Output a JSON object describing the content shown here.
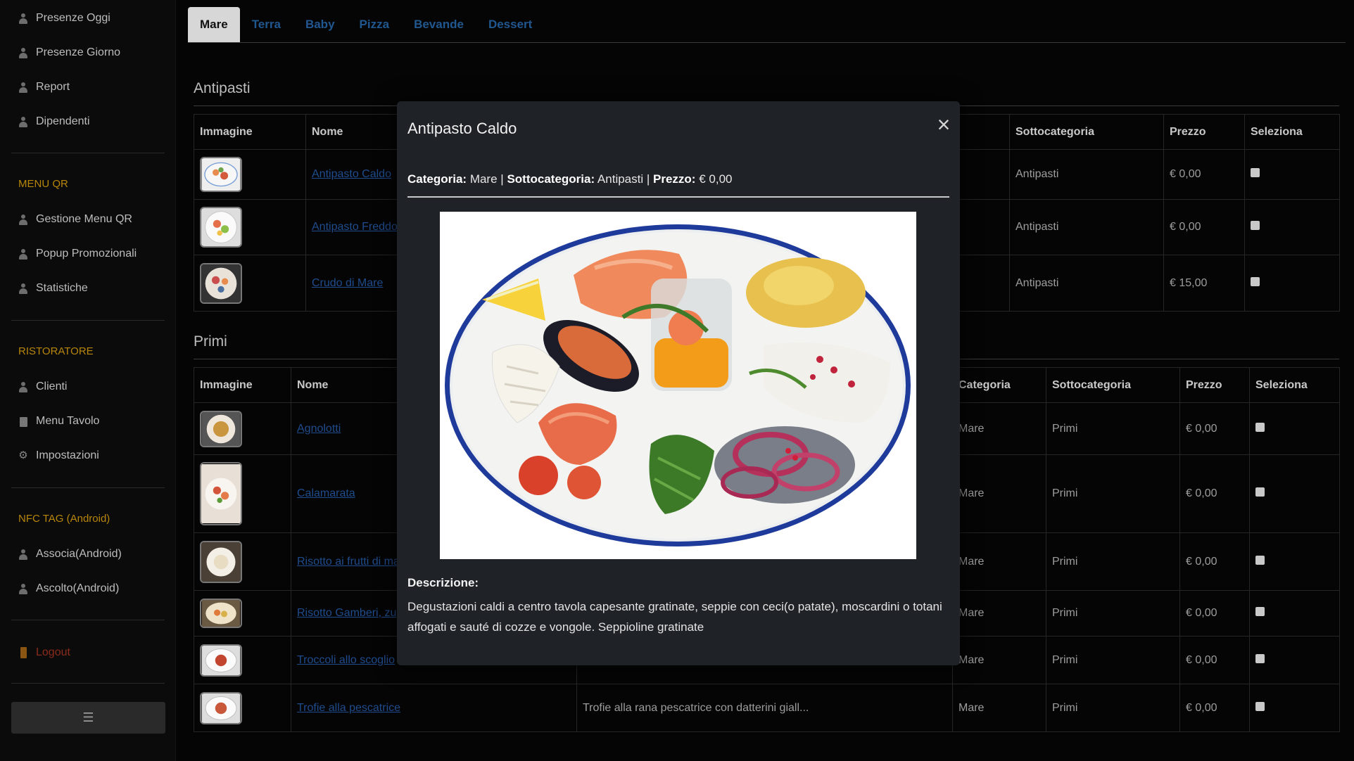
{
  "sidebar": {
    "items_top": [
      "Presenze Oggi",
      "Presenze Giorno",
      "Report",
      "Dipendenti"
    ],
    "menu_qr_heading": "MENU QR",
    "menu_qr_items": [
      "Gestione Menu QR",
      "Popup Promozionali",
      "Statistiche"
    ],
    "ristoratore_heading": "RISTORATORE",
    "ristoratore_items": [
      "Clienti",
      "Menu Tavolo",
      "Impostazioni"
    ],
    "nfc_heading": "NFC TAG (Android)",
    "nfc_items": [
      "Associa(Android)",
      "Ascolto(Android)"
    ],
    "logout": "Logout",
    "toggle": "☰"
  },
  "tabs": [
    "Mare",
    "Terra",
    "Baby",
    "Pizza",
    "Bevande",
    "Dessert"
  ],
  "antipasti": {
    "title": "Antipasti",
    "headers": [
      "Immagine",
      "Nome",
      "Sottocategoria",
      "Prezzo",
      "Seleziona"
    ],
    "rows": [
      {
        "name": "Antipasto Caldo",
        "sub": "Antipasti",
        "price": "€ 0,00"
      },
      {
        "name": "Antipasto Freddo",
        "sub": "Antipasti",
        "price": "€ 0,00"
      },
      {
        "name": "Crudo di Mare",
        "sub": "Antipasti",
        "price": "€ 15,00"
      }
    ]
  },
  "primi": {
    "title": "Primi",
    "headers": [
      "Immagine",
      "Nome",
      "Categoria",
      "Sottocategoria",
      "Prezzo",
      "Seleziona"
    ],
    "rows": [
      {
        "name": "Agnolotti",
        "desc": "",
        "cat": "Mare",
        "sub": "Primi",
        "price": "€ 0,00"
      },
      {
        "name": "Calamarata",
        "desc": "",
        "cat": "Mare",
        "sub": "Primi",
        "price": "€ 0,00"
      },
      {
        "name": "Risotto ai frutti di ma",
        "desc": "",
        "cat": "Mare",
        "sub": "Primi",
        "price": "€ 0,00"
      },
      {
        "name": "Risotto Gamberi, zu",
        "desc": "",
        "cat": "Mare",
        "sub": "Primi",
        "price": "€ 0,00"
      },
      {
        "name": "Troccoli allo scoglio",
        "desc": "",
        "cat": "Mare",
        "sub": "Primi",
        "price": "€ 0,00"
      },
      {
        "name": "Trofie alla pescatrice",
        "desc": "Trofie alla rana pescatrice con datterini giall...",
        "cat": "Mare",
        "sub": "Primi",
        "price": "€ 0,00"
      }
    ]
  },
  "modal": {
    "title": "Antipasto Caldo",
    "close": "×",
    "categoria_label": "Categoria:",
    "categoria": "Mare",
    "sottocategoria_label": "Sottocategoria:",
    "sottocategoria": "Antipasti",
    "prezzo_label": "Prezzo:",
    "prezzo": "€ 0,00",
    "sep": "|",
    "descrizione_label": "Descrizione:",
    "descrizione": "Degustazioni caldi a centro tavola capesante gratinate, seppie con ceci(o patate), moscardini o totani affogati e sauté di cozze e vongole. Seppioline gratinate"
  },
  "colors": {
    "link": "#1f4c8d",
    "heading_orange": "#b8860b",
    "logout": "#8b2b1c",
    "modal_bg": "#1f2327"
  }
}
